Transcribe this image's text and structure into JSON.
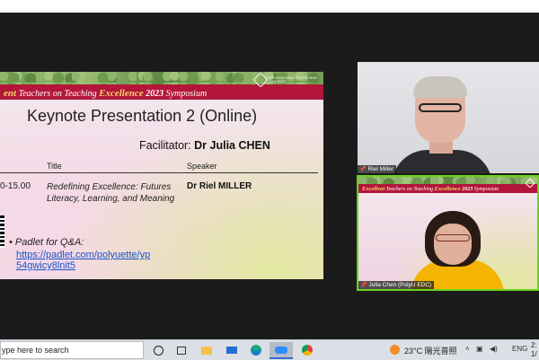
{
  "main_slide": {
    "banner": {
      "prefix": "ent",
      "teachers_on": "Teachers",
      "on": "on",
      "teaching": "Teaching",
      "excellence": "Excellence",
      "year": "2023",
      "symposium": "Symposium",
      "logo_text": "THE HONG KONG POLYTECHNIC UNIVERSITY"
    },
    "title": "Keynote Presentation 2 (Online)",
    "facilitator_label": "Facilitator:",
    "facilitator_name": "Dr Julia CHEN",
    "columns": {
      "title": "Title",
      "speaker": "Speaker"
    },
    "row": {
      "time": "0-15.00",
      "session_title": "Redefining Excellence: Futures Literacy, Learning, and Meaning",
      "speaker": "Dr Riel MILLER"
    },
    "padlet_label": "Padlet for Q&A:",
    "padlet_link": "https://padlet.com/polyuette/yp54gwicy8lnit5"
  },
  "participants": [
    {
      "name": "Riel Miller"
    },
    {
      "name": "Julia Chen (PolyU EDC)"
    }
  ],
  "tile2_banner": {
    "excellent": "Excellent",
    "teachers": "Teachers",
    "on": "on",
    "teaching": "Teaching",
    "excellence": "Excellence",
    "year": "2023",
    "symposium": "Symposium"
  },
  "taskbar": {
    "search_placeholder": "ype here to search",
    "temperature": "23°C",
    "weather": "陽光普照",
    "language": "ENG",
    "time": "2:",
    "date": "1/"
  },
  "icons": [
    "cortana-icon",
    "task-view-icon",
    "file-explorer-icon",
    "mail-icon",
    "edge-icon",
    "zoom-icon",
    "chrome-icon",
    "weather-icon"
  ]
}
